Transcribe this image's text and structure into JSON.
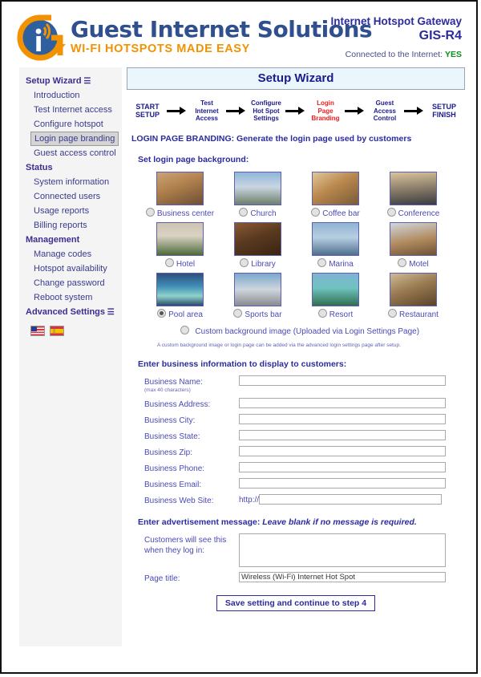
{
  "header": {
    "brand_name": "Guest Internet Solutions",
    "brand_tagline": "WI-FI HOTSPOTS MADE EASY",
    "gateway_label": "Internet Hotspot Gateway",
    "model": "GIS-R4",
    "connected_label": "Connected to the Internet:",
    "connected_value": "YES",
    "logo_icon": "guest-internet-logo-icon"
  },
  "sidebar": {
    "groups": [
      {
        "title": "Setup Wizard",
        "arrow": "☰",
        "has_arrow": true,
        "items": [
          {
            "label": "Introduction",
            "selected": false
          },
          {
            "label": "Test Internet access",
            "selected": false
          },
          {
            "label": "Configure hotspot",
            "selected": false
          },
          {
            "label": "Login page branding",
            "selected": true
          },
          {
            "label": "Guest access control",
            "selected": false
          }
        ]
      },
      {
        "title": "Status",
        "has_arrow": false,
        "items": [
          {
            "label": "System information",
            "selected": false
          },
          {
            "label": "Connected users",
            "selected": false
          },
          {
            "label": "Usage reports",
            "selected": false
          },
          {
            "label": "Billing reports",
            "selected": false
          }
        ]
      },
      {
        "title": "Management",
        "has_arrow": false,
        "items": [
          {
            "label": "Manage codes",
            "selected": false
          },
          {
            "label": "Hotspot availability",
            "selected": false
          },
          {
            "label": "Change password",
            "selected": false
          },
          {
            "label": "Reboot system",
            "selected": false
          }
        ]
      },
      {
        "title": "Advanced Settings",
        "has_arrow": true,
        "items": []
      }
    ],
    "flags": [
      {
        "name": "flag-us-icon",
        "title": "English"
      },
      {
        "name": "flag-es-icon",
        "title": "Español"
      }
    ]
  },
  "main": {
    "wizard_title": "Setup Wizard",
    "steps": [
      {
        "label": "START\nSETUP",
        "active": false,
        "edge": true
      },
      {
        "label": "Test\nInternet\nAccess",
        "active": false,
        "edge": false
      },
      {
        "label": "Configure\nHot Spot\nSettings",
        "active": false,
        "edge": false
      },
      {
        "label": "Login\nPage\nBranding",
        "active": true,
        "edge": false
      },
      {
        "label": "Guest\nAccess\nControl",
        "active": false,
        "edge": false
      },
      {
        "label": "SETUP\nFINISH",
        "active": false,
        "edge": true
      }
    ],
    "page_heading": "LOGIN PAGE BRANDING: Generate the login page used by customers",
    "background_section_heading": "Set login page background:",
    "backgrounds": [
      {
        "label": "Business center",
        "selected": false,
        "thumb": "t-biz"
      },
      {
        "label": "Church",
        "selected": false,
        "thumb": "t-church"
      },
      {
        "label": "Coffee bar",
        "selected": false,
        "thumb": "t-coffee"
      },
      {
        "label": "Conference",
        "selected": false,
        "thumb": "t-conf"
      },
      {
        "label": "Hotel",
        "selected": false,
        "thumb": "t-hotel"
      },
      {
        "label": "Library",
        "selected": false,
        "thumb": "t-library"
      },
      {
        "label": "Marina",
        "selected": false,
        "thumb": "t-marina"
      },
      {
        "label": "Motel",
        "selected": false,
        "thumb": "t-motel"
      },
      {
        "label": "Pool area",
        "selected": true,
        "thumb": "t-pool"
      },
      {
        "label": "Sports bar",
        "selected": false,
        "thumb": "t-sports"
      },
      {
        "label": "Resort",
        "selected": false,
        "thumb": "t-resort"
      },
      {
        "label": "Restaurant",
        "selected": false,
        "thumb": "t-rest"
      }
    ],
    "custom_background_label": "Custom background image (Uploaded via Login Settings Page)",
    "custom_background_selected": false,
    "custom_note": "A custom background image or login page can be added via the advanced login settings page after setup.",
    "business_section_heading": "Enter business information to display to customers:",
    "fields": {
      "name_label": "Business Name:",
      "name_hint": "(max 40 characters)",
      "name_value": "",
      "address_label": "Business Address:",
      "address_value": "",
      "city_label": "Business City:",
      "city_value": "",
      "state_label": "Business State:",
      "state_value": "",
      "zip_label": "Business Zip:",
      "zip_value": "",
      "phone_label": "Business Phone:",
      "phone_value": "",
      "email_label": "Business Email:",
      "email_value": "",
      "website_label": "Business Web Site:",
      "website_prefix": "http://",
      "website_value": ""
    },
    "ad_section_heading": "Enter advertisement message:",
    "ad_section_note": "Leave blank if no message is required.",
    "ad_label": "Customers will see this when they log in:",
    "ad_value": "",
    "page_title_label": "Page title:",
    "page_title_value": "Wireless (Wi-Fi) Internet Hot Spot",
    "save_button": "Save setting and continue to step 4"
  },
  "colors": {
    "brand_blue": "#2f4f8f",
    "brand_orange": "#f39200",
    "nav_blue": "#3b3b8c",
    "accent_navy": "#2b2b9e",
    "active_red": "#ef1b1b",
    "connected_green": "#0a8f1e",
    "title_bar_bg": "#eaf5fc"
  }
}
